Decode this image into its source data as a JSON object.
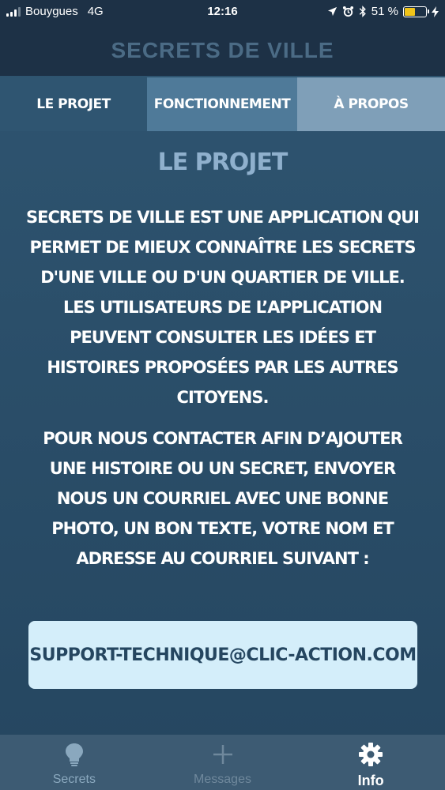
{
  "status_bar": {
    "carrier": "Bouygues",
    "network": "4G",
    "time": "12:16",
    "battery_percent": "51 %",
    "battery_level": 0.51
  },
  "header": {
    "title": "SECRETS DE VILLE"
  },
  "tabs": [
    {
      "label": "LE PROJET",
      "selected": true
    },
    {
      "label": "FONCTIONNEMENT",
      "selected": false
    },
    {
      "label": "À PROPOS",
      "selected": false
    }
  ],
  "content": {
    "title": "LE PROJET",
    "paragraph1": "SECRETS DE VILLE EST UNE APPLICATION QUI PERMET DE MIEUX CONNAÎTRE LES SECRETS D'UNE VILLE OU D'UN QUARTIER DE VILLE. LES UTILISATEURS DE L’APPLICATION PEUVENT CONSULTER LES IDÉES ET HISTOIRES PROPOSÉES PAR LES AUTRES CITOYENS.",
    "paragraph2": "POUR NOUS CONTACTER AFIN D’AJOUTER UNE HISTOIRE OU UN SECRET, ENVOYER NOUS UN COURRIEL AVEC UNE BONNE PHOTO, UN BON TEXTE, VOTRE NOM ET ADRESSE AU COURRIEL SUIVANT :",
    "email": "SUPPORT-TECHNIQUE@CLIC-ACTION.COM"
  },
  "tabbar": [
    {
      "label": "Secrets",
      "icon": "lightbulb-icon",
      "active": false
    },
    {
      "label": "Messages",
      "icon": "plus-icon",
      "active": false
    },
    {
      "label": "Info",
      "icon": "gear-icon",
      "active": true
    }
  ],
  "colors": {
    "background": "#2f5571",
    "header": "#1d3146",
    "email_box": "#d4eefa",
    "section_title": "#8fb0cd"
  }
}
